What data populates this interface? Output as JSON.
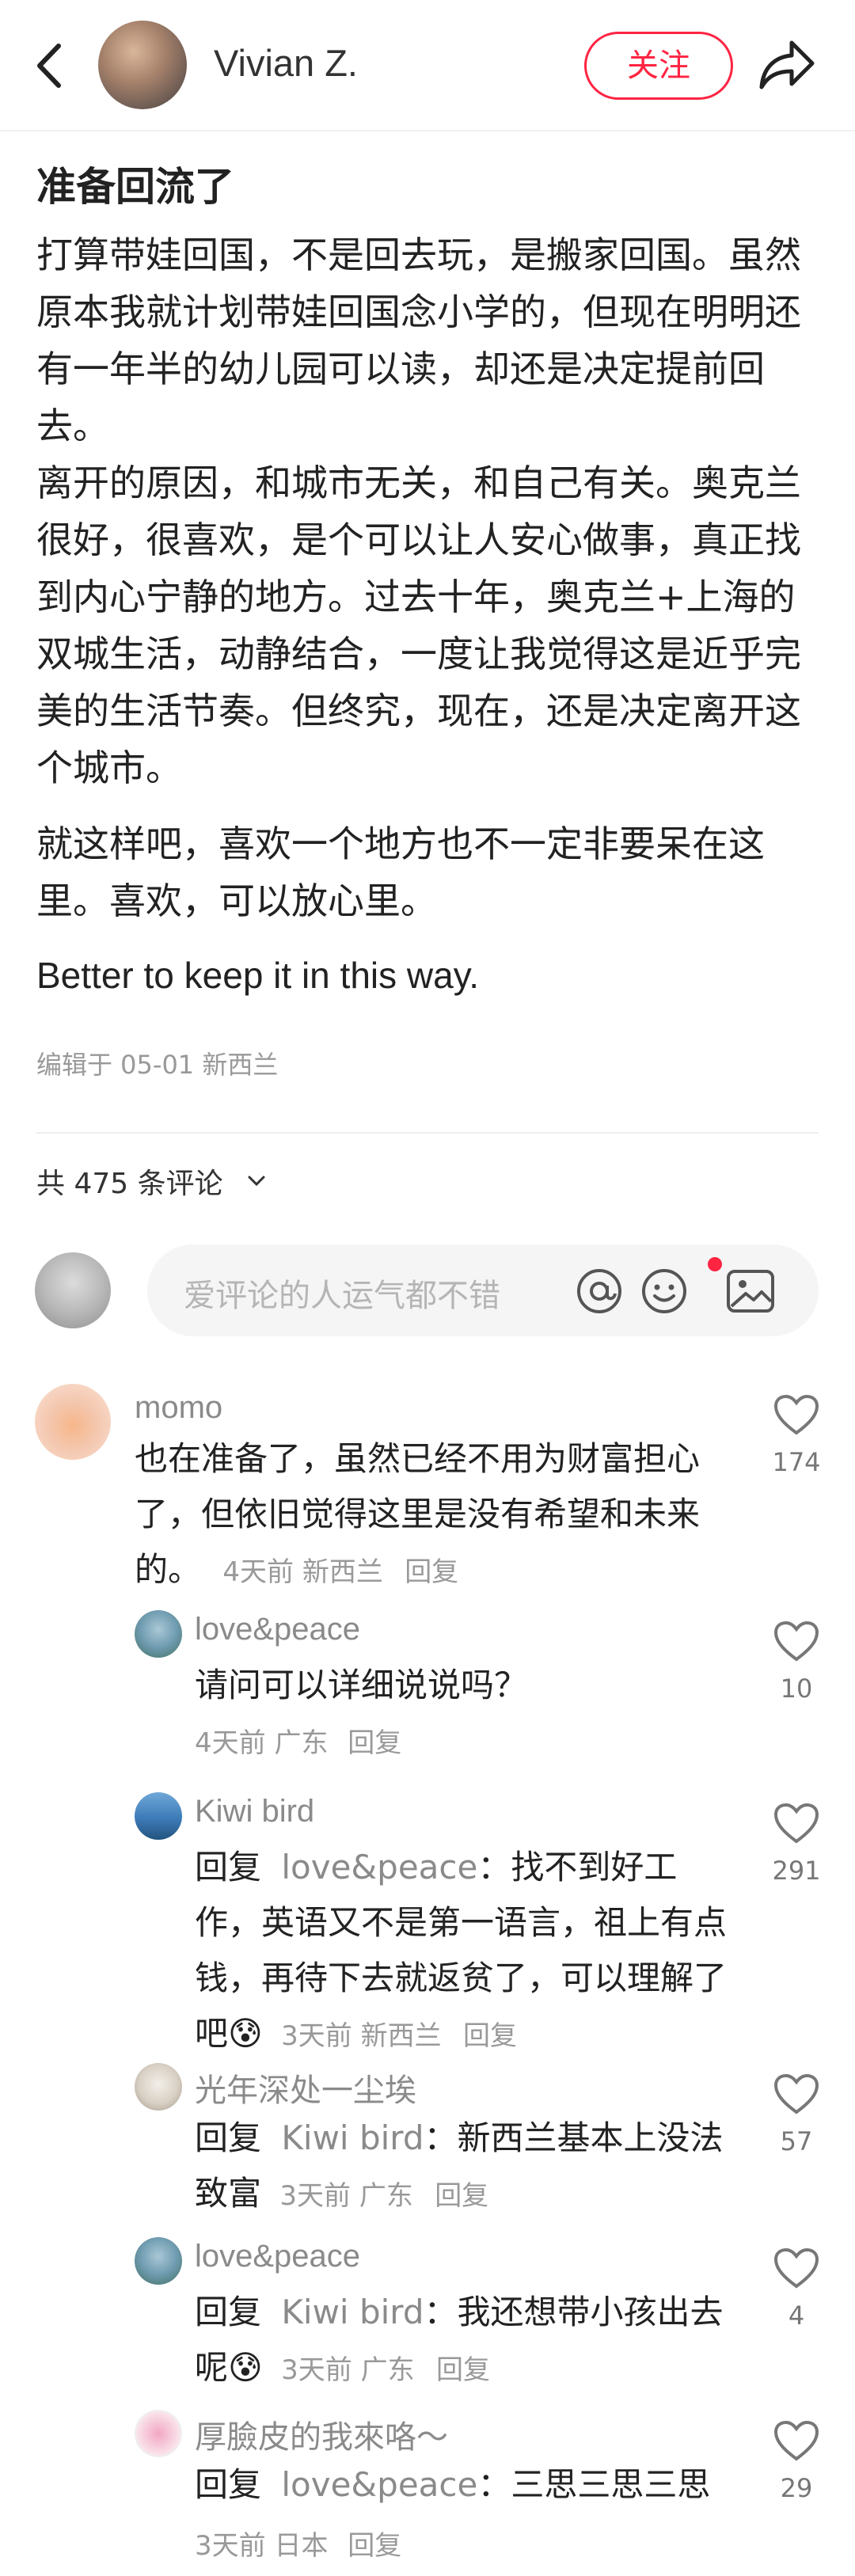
{
  "header": {
    "author": "Vivian Z.",
    "follow_label": "关注"
  },
  "post": {
    "title": "准备回流了",
    "paragraph1": "打算带娃回国，不是回去玩，是搬家回国。虽然原本我就计划带娃回国念小学的，但现在明明还有一年半的幼儿园可以读，却还是决定提前回去。\n离开的原因，和城市无关，和自己有关。奥克兰很好，很喜欢，是个可以让人安心做事，真正找到内心宁静的地方。过去十年，奥克兰+上海的双城生活，动静结合，一度让我觉得这是近乎完美的生活节奏。但终究，现在，还是决定离开这个城市。",
    "paragraph2": "就这样吧，喜欢一个地方也不一定非要呆在这里。喜欢，可以放心里。",
    "paragraph3": "Better to keep it in this way.",
    "meta": "编辑于 05-01 新西兰"
  },
  "comments_header": {
    "count_label": "共 475 条评论"
  },
  "input": {
    "placeholder": "爱评论的人运气都不错"
  },
  "colors": {
    "accent": "#ff2442",
    "muted": "#999999"
  },
  "icons": [
    "back-arrow-icon",
    "share-icon",
    "chevron-down-icon",
    "at-icon",
    "emoji-icon",
    "image-icon",
    "heart-icon"
  ],
  "comments": [
    {
      "name": "momo",
      "text": "也在准备了，虽然已经不用为财富担心了，但依旧觉得这里是没有希望和未来的。",
      "meta": "4天前 新西兰",
      "reply_label": "回复",
      "likes": "174"
    },
    {
      "name": "love&peace",
      "text": "请问可以详细说说吗？",
      "meta": "4天前 广东",
      "reply_label": "回复",
      "likes": "10"
    },
    {
      "name": "Kiwi bird",
      "reply_prefix": "回复",
      "reply_to": "love&peace",
      "text": "：找不到好工作，英语又不是第一语言，祖上有点钱，再待下去就返贫了，可以理解了吧",
      "emoji": "😰",
      "meta": "3天前 新西兰",
      "reply_label": "回复",
      "likes": "291"
    },
    {
      "name": "光年深处一尘埃",
      "reply_prefix": "回复",
      "reply_to": "Kiwi bird",
      "text": "：新西兰基本上没法致富",
      "meta": "3天前 广东",
      "reply_label": "回复",
      "likes": "57"
    },
    {
      "name": "love&peace",
      "reply_prefix": "回复",
      "reply_to": "Kiwi bird",
      "text": "：我还想带小孩出去呢",
      "emoji": "😰",
      "meta": "3天前 广东",
      "reply_label": "回复",
      "likes": "4"
    },
    {
      "name": "厚臉皮的我來咯～",
      "reply_prefix": "回复",
      "reply_to": "love&peace",
      "text": "：三思三思三思",
      "meta": "3天前 日本",
      "reply_label": "回复",
      "likes": "29"
    }
  ]
}
